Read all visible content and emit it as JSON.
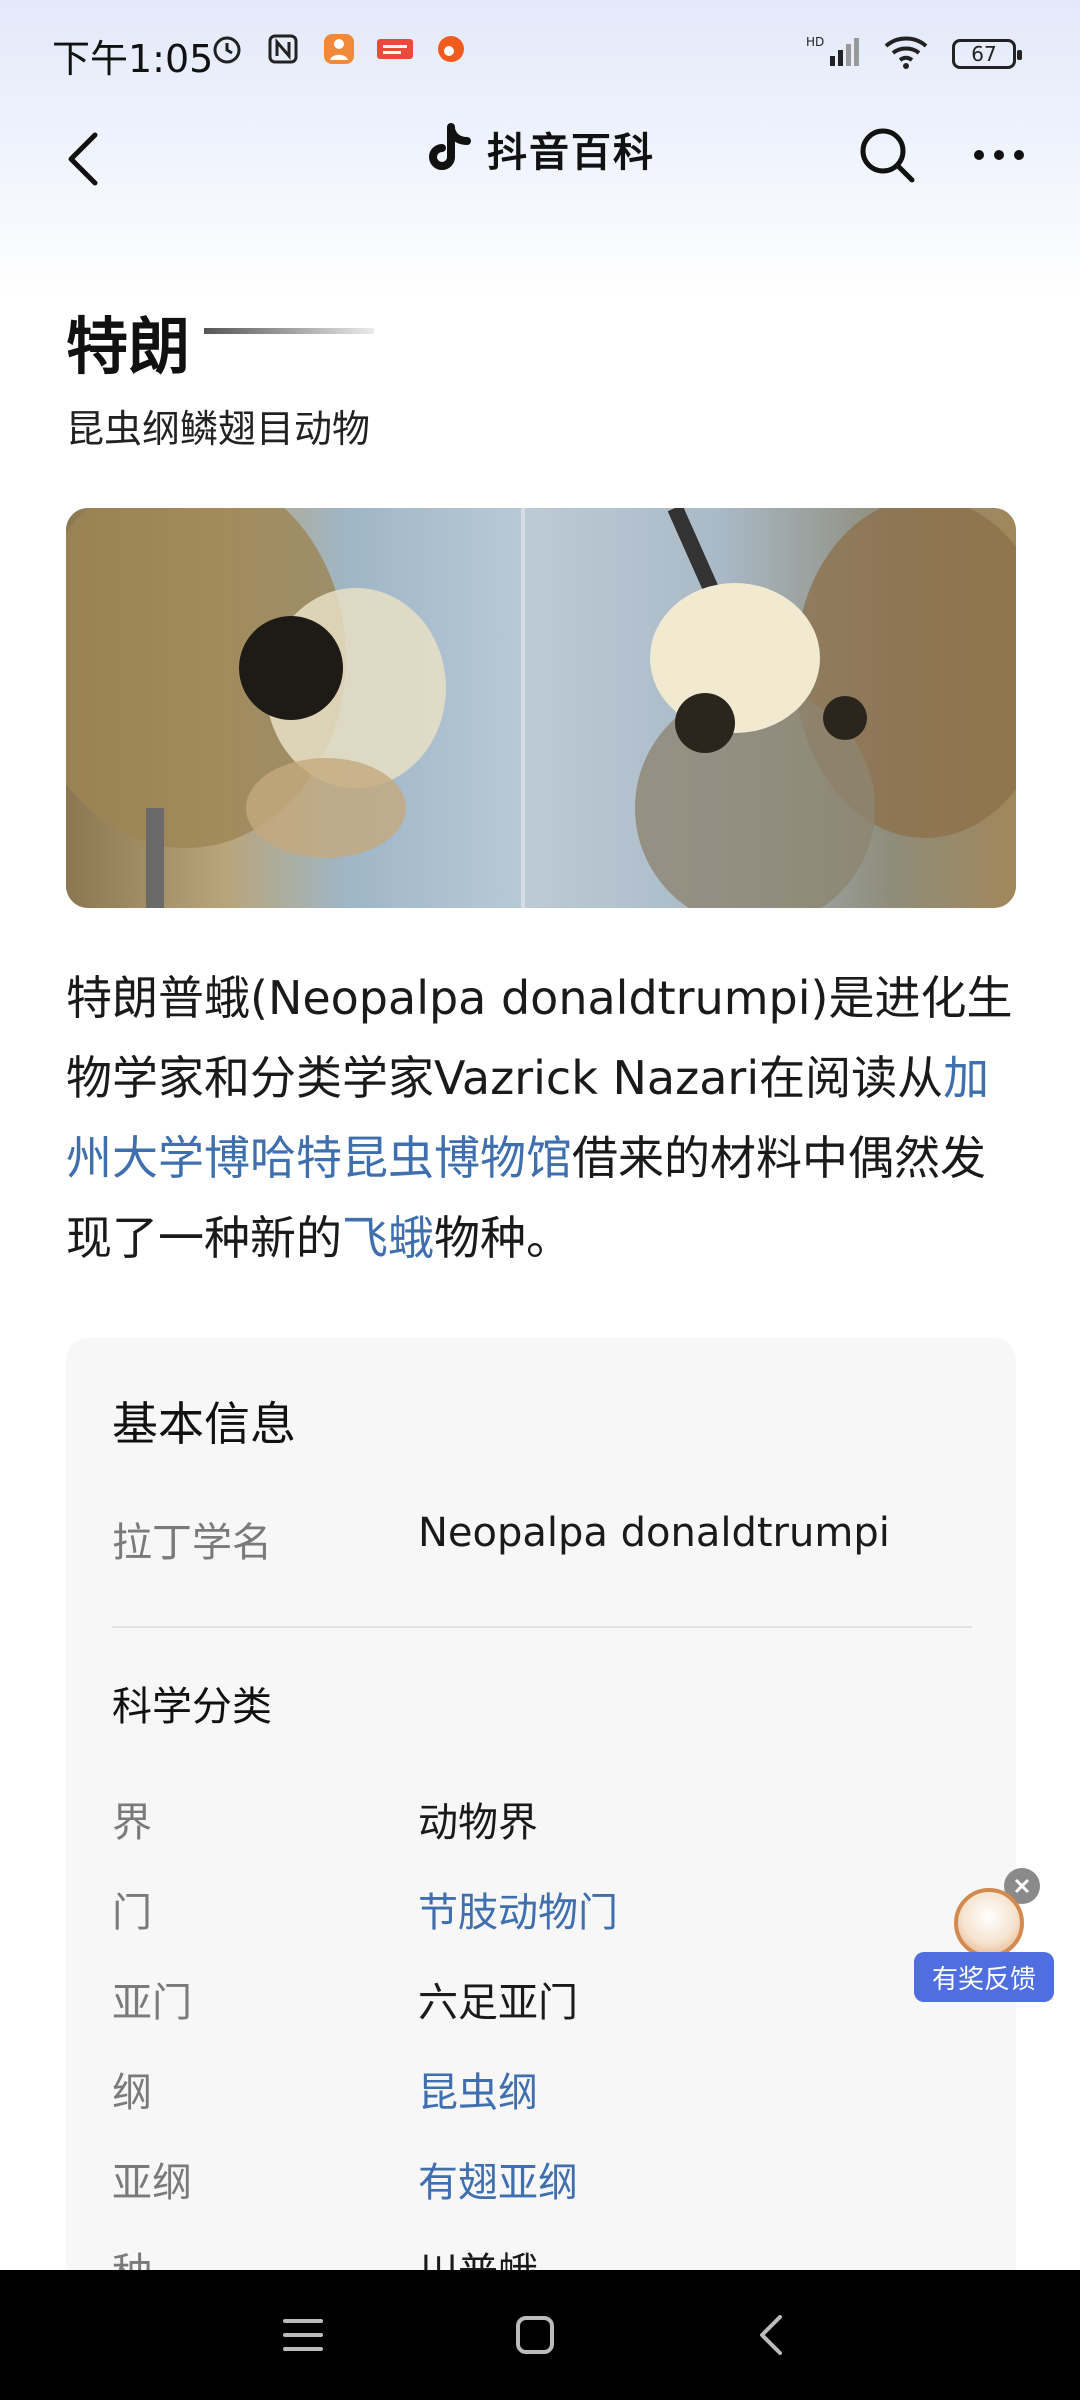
{
  "status_bar": {
    "time": "下午1:05",
    "battery": "67",
    "network": "HD"
  },
  "nav": {
    "title": "抖音百科"
  },
  "entry": {
    "title": "特朗",
    "subtitle": "昆虫纲鳞翅目动物"
  },
  "intro": {
    "p1": "特朗普蛾(Neopalpa donaldtrumpi)是进化生物学家和分类学家Vazrick Nazari在阅读从",
    "link1": "加州大学博哈特昆虫博物馆",
    "p2": "借来的材料中偶然发现了一种新的",
    "link2": "飞蛾",
    "p3": "物种。"
  },
  "info_card": {
    "title": "基本信息",
    "latin_label": "拉丁学名",
    "latin_value": "Neopalpa donaldtrumpi",
    "section_title": "科学分类",
    "rows": [
      {
        "label": "界",
        "value": "动物界"
      },
      {
        "label": "门",
        "value": "节肢动物门"
      },
      {
        "label": "亚门",
        "value": "六足亚门"
      },
      {
        "label": "纲",
        "value": "昆虫纲"
      },
      {
        "label": "亚纲",
        "value": "有翅亚纲"
      },
      {
        "label": "种",
        "value": "川普蛾"
      }
    ]
  },
  "feedback": {
    "label": "有奖反馈"
  },
  "colors": {
    "link": "#3f6fae",
    "feedback_bg": "#4f6fe0"
  }
}
